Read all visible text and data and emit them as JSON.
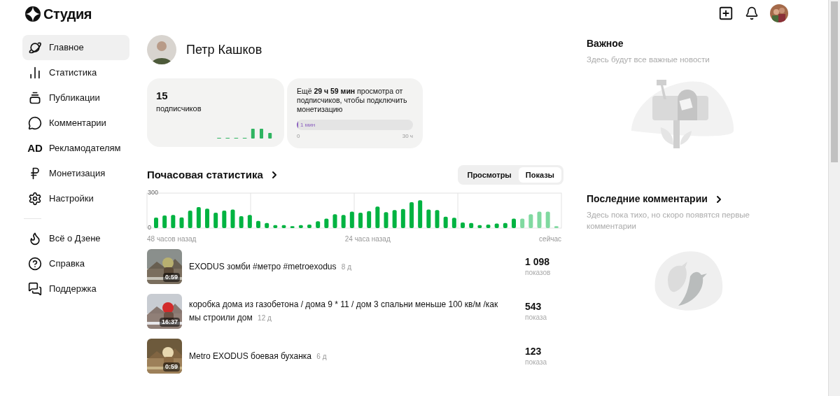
{
  "header": {
    "logo": "Студия"
  },
  "sidebar": {
    "items": [
      {
        "kind": "home",
        "label": "Главное",
        "selected": true
      },
      {
        "kind": "stats",
        "label": "Статистика",
        "selected": false
      },
      {
        "kind": "publications",
        "label": "Публикации",
        "selected": false
      },
      {
        "kind": "comments",
        "label": "Комментарии",
        "selected": false
      },
      {
        "kind": "advertisers",
        "icon_text": "AD",
        "label": "Рекламодателям",
        "selected": false
      },
      {
        "kind": "monetization",
        "label": "Монетизация",
        "selected": false
      },
      {
        "kind": "settings",
        "label": "Настройки",
        "selected": false
      }
    ],
    "secondary_items": [
      {
        "kind": "about",
        "label": "Всё о Дзене"
      },
      {
        "kind": "help",
        "label": "Справка"
      },
      {
        "kind": "support",
        "label": "Поддержка"
      }
    ]
  },
  "profile": {
    "name": "Петр Кашков"
  },
  "subscribers": {
    "count": "15",
    "label": "подписчиков"
  },
  "monetization": {
    "text": "Ещё **29 ч 59 мин** просмотра от подписчиков, чтобы подключить монетизацию",
    "level": 0.005,
    "reading": "1 мин",
    "min": "0",
    "max": "30 ч"
  },
  "hourly": {
    "title": "Почасовая статистика",
    "tabs": [
      {
        "label": "Просмотры",
        "selected": false
      },
      {
        "label": "Показы",
        "selected": true
      }
    ],
    "x_labels": [
      "48 часов назад",
      "24 часа назад",
      "сейчас"
    ],
    "chart_data": {
      "type": "bar",
      "ylim": [
        0,
        300
      ],
      "yticks": [
        0,
        300
      ],
      "stacked": true,
      "categories": [
        null,
        null,
        null,
        null,
        null,
        null,
        null,
        null,
        null,
        null,
        null,
        null,
        null,
        null,
        null,
        null,
        null,
        null,
        null,
        null,
        null,
        null,
        null,
        null,
        null,
        null,
        null,
        null,
        null,
        null,
        null,
        null,
        null,
        null,
        null,
        null,
        null,
        null,
        null,
        null,
        null,
        null,
        null,
        null,
        null,
        null,
        null,
        null
      ],
      "series": [
        {
          "color": "#00b341",
          "values": [
            90,
            108,
            113,
            92,
            150,
            180,
            166,
            132,
            150,
            159,
            102,
            113,
            62,
            44,
            25,
            25,
            16,
            25,
            30,
            58,
            81,
            118,
            113,
            141,
            132,
            145,
            185,
            136,
            155,
            164,
            222,
            238,
            159,
            155,
            97,
            88,
            48,
            44,
            25,
            30,
            39,
            44,
            81,
            null,
            null,
            null,
            null,
            null
          ]
        },
        {
          "color": "#80d9a0",
          "values": [
            null,
            null,
            null,
            null,
            null,
            null,
            null,
            null,
            null,
            null,
            null,
            null,
            null,
            null,
            null,
            null,
            null,
            null,
            null,
            null,
            null,
            null,
            null,
            null,
            null,
            null,
            null,
            null,
            null,
            null,
            null,
            null,
            null,
            null,
            null,
            null,
            null,
            null,
            null,
            null,
            null,
            null,
            null,
            81,
            118,
            141,
            141,
            16
          ]
        }
      ]
    }
  },
  "publications": [
    {
      "duration": "0:59",
      "title": "EXODUS зомби #метро #metroexodus",
      "age": "8 д",
      "count": "1 098",
      "unit": "показов"
    },
    {
      "duration": "16:37",
      "title": "коробка дома из газобетона / дома 9 * 11 / дом 3 спальни меньше 100 кв/м /как мы строили дом",
      "age": "12 д",
      "count": "543",
      "unit": "показа"
    },
    {
      "duration": "0:59",
      "title": "Metro EXODUS боевая буханка",
      "age": "6 д",
      "count": "123",
      "unit": "показа"
    }
  ],
  "important": {
    "title": "Важное",
    "text": "Здесь будут все важные новости"
  },
  "comments": {
    "title": "Последние комментарии",
    "text": "Здесь пока тихо, но скоро появятся первые комментарии"
  }
}
